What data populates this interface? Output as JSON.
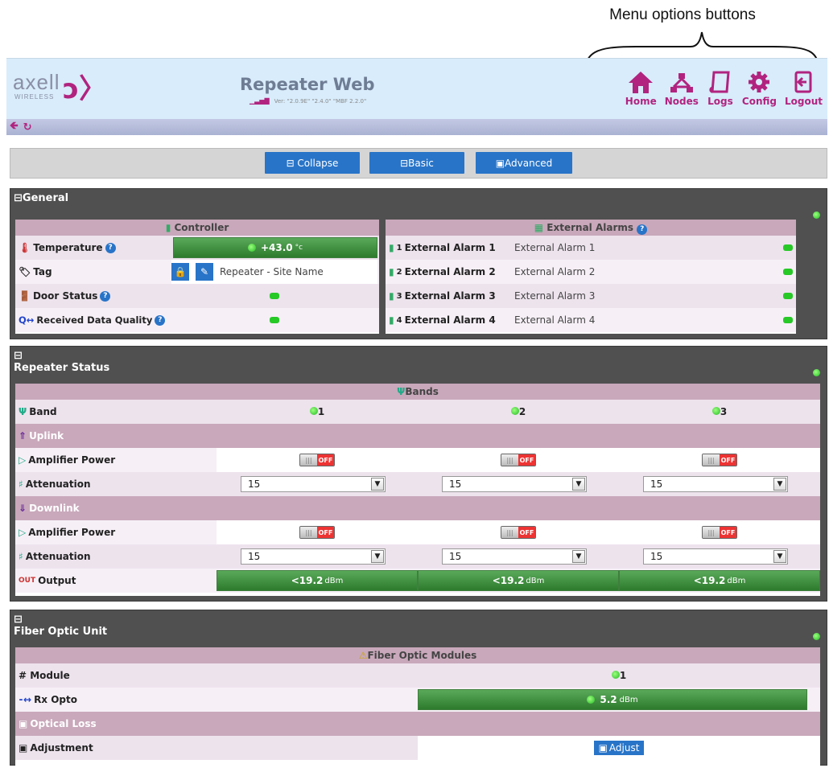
{
  "annotation": {
    "text": "Menu options buttons"
  },
  "header": {
    "logo_word": "axell",
    "logo_sub": "WIRELESS",
    "title": "Repeater Web",
    "version": "Ver: \"2.0.9E\" \"2.4.0\" \"MBF 2.2.0\""
  },
  "menu": [
    {
      "label": "Home",
      "icon": "home-icon"
    },
    {
      "label": "Nodes",
      "icon": "nodes-icon"
    },
    {
      "label": "Logs",
      "icon": "logs-icon"
    },
    {
      "label": "Config",
      "icon": "gear-icon"
    },
    {
      "label": "Logout",
      "icon": "logout-icon"
    }
  ],
  "toolbar": {
    "collapse": "⊟ Collapse",
    "basic": "⊟Basic",
    "advanced": "▣Advanced"
  },
  "general": {
    "title": "⊟General",
    "controller": {
      "header": "Controller",
      "temperature_label": "Temperature",
      "temperature_value": "+43.0",
      "temperature_unit": "°c",
      "tag_label": "Tag",
      "tag_value": "Repeater - Site Name",
      "door_label": "Door Status",
      "rdq_label": "Received Data Quality"
    },
    "alarms": {
      "header": "External Alarms",
      "items": [
        {
          "num": "1",
          "label": "External Alarm 1",
          "value": "External Alarm 1"
        },
        {
          "num": "2",
          "label": "External Alarm 2",
          "value": "External Alarm 2"
        },
        {
          "num": "3",
          "label": "External Alarm 3",
          "value": "External Alarm 3"
        },
        {
          "num": "4",
          "label": "External Alarm 4",
          "value": "External Alarm 4"
        }
      ]
    }
  },
  "repeater": {
    "collapse_glyph": "⊟",
    "title": "Repeater Status",
    "bands_header": "Bands",
    "band_label": "Band",
    "bands": [
      "1",
      "2",
      "3"
    ],
    "uplink": "Uplink",
    "downlink": "Downlink",
    "amp_label": "Amplifier Power",
    "atten_label": "Attenuation",
    "toggle_text": "OFF",
    "atten_value": "15",
    "output_label": "Output",
    "output_value": "<19.2",
    "output_unit": "dBm"
  },
  "fiber": {
    "collapse_glyph": "⊟",
    "title": "Fiber Optic Unit",
    "modules_header": "Fiber Optic Modules",
    "module_label": "# Module",
    "module_value": "1",
    "rx_label": "Rx Opto",
    "rx_value": "5.2",
    "rx_unit": "dBm",
    "optical_loss": "Optical Loss",
    "adjustment_label": "Adjustment",
    "adjust_button": "Adjust"
  },
  "colors": {
    "accent": "#b1237f",
    "button_blue": "#2874c8",
    "band_bg": "#c9a8bb",
    "status_green": "#2d7a2d"
  }
}
